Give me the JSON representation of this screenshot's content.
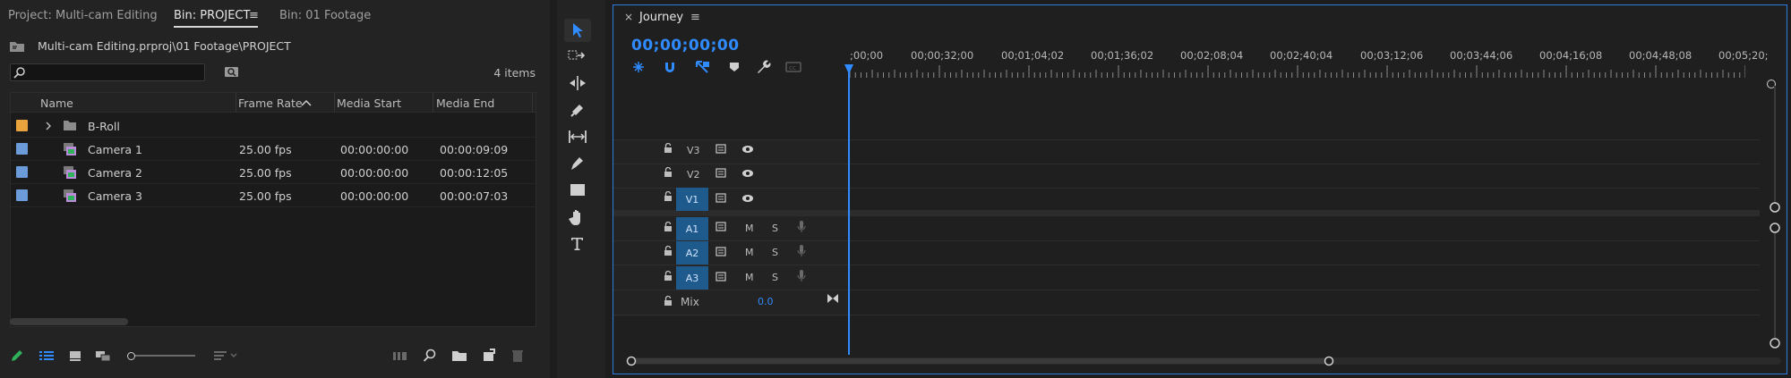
{
  "project_panel": {
    "tabs": [
      {
        "label": "Project: Multi-cam Editing"
      },
      {
        "label": "Bin: PROJECT",
        "active": true
      },
      {
        "label": "Bin: 01 Footage"
      }
    ],
    "menu_glyph": "≡",
    "path": "Multi-cam Editing.prproj\\01 Footage\\PROJECT",
    "search": {
      "value": "",
      "placeholder": ""
    },
    "items_count": "4 items",
    "columns": [
      "Name",
      "Frame Rate",
      "Media Start",
      "Media End"
    ],
    "rows": [
      {
        "name": "B-Roll",
        "type": "folder",
        "label_color": "#e8a33d",
        "frame_rate": "",
        "media_start": "",
        "media_end": ""
      },
      {
        "name": "Camera 1",
        "type": "multicam",
        "label_color": "#6b9bd8",
        "frame_rate": "25.00 fps",
        "media_start": "00:00:00:00",
        "media_end": "00:00:09:09"
      },
      {
        "name": "Camera 2",
        "type": "multicam",
        "label_color": "#6b9bd8",
        "frame_rate": "25.00 fps",
        "media_start": "00:00:00:00",
        "media_end": "00:00:12:05"
      },
      {
        "name": "Camera 3",
        "type": "multicam",
        "label_color": "#6b9bd8",
        "frame_rate": "25.00 fps",
        "media_start": "00:00:00:00",
        "media_end": "00:00:07:03"
      }
    ],
    "bottom_tools": [
      "pencil-icon",
      "list-view-icon",
      "icon-view-icon",
      "freeform-view-icon",
      "zoom-slider",
      "sort-icon",
      "automate-icon",
      "find-icon",
      "new-bin-icon",
      "new-item-icon",
      "trash-icon"
    ]
  },
  "tools": [
    "selection",
    "track-select-forward",
    "ripple-edit",
    "razor",
    "slip",
    "pen",
    "rectangle",
    "hand",
    "type"
  ],
  "timeline": {
    "close_glyph": "×",
    "sequence_name": "Journey",
    "menu_glyph": "≡",
    "timecode": "00;00;00;00",
    "ruler_labels": [
      ";00;00",
      "00;00;32;00",
      "00;01;04;02",
      "00;01;36;02",
      "00;02;08;04",
      "00;02;40;04",
      "00;03;12;06",
      "00;03;44;06",
      "00;04;16;08",
      "00;04;48;08",
      "00;05;20;"
    ],
    "video_tracks": [
      {
        "name": "V3",
        "targeted": false
      },
      {
        "name": "V2",
        "targeted": false
      },
      {
        "name": "V1",
        "targeted": true
      }
    ],
    "audio_tracks": [
      {
        "name": "A1",
        "m": "M",
        "s": "S"
      },
      {
        "name": "A2",
        "m": "M",
        "s": "S"
      },
      {
        "name": "A3",
        "m": "M",
        "s": "S"
      }
    ],
    "mix": {
      "label": "Mix",
      "value": "0.0"
    },
    "accent_color": "#2f8bff"
  }
}
